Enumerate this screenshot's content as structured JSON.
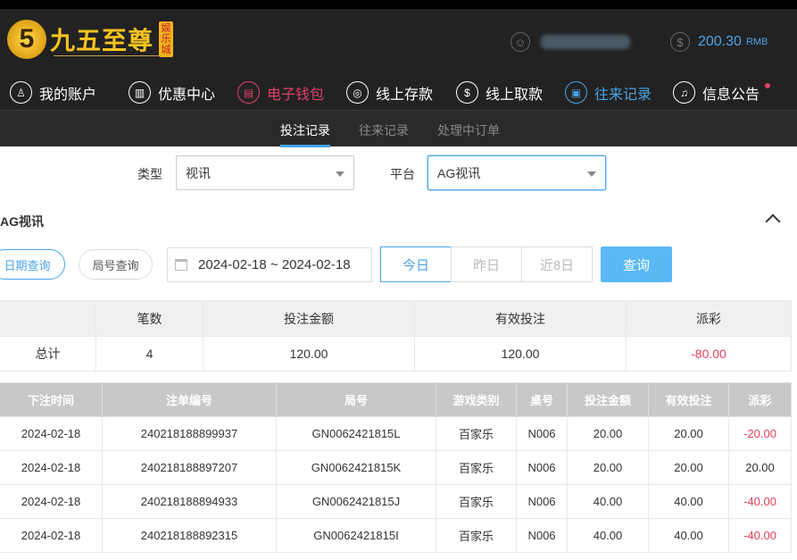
{
  "header": {
    "logo_mark": "5",
    "logo_text": "九五至尊",
    "logo_badge": "娱乐城",
    "balance": "200.30",
    "currency": "RMB"
  },
  "nav": [
    {
      "label": "我的账户",
      "icon": "user-icon"
    },
    {
      "label": "优惠中心",
      "icon": "gift-icon"
    },
    {
      "label": "电子钱包",
      "icon": "wallet-icon"
    },
    {
      "label": "线上存款",
      "icon": "deposit-icon"
    },
    {
      "label": "线上取款",
      "icon": "withdraw-icon"
    },
    {
      "label": "往来记录",
      "icon": "records-icon"
    },
    {
      "label": "信息公告",
      "icon": "bell-icon"
    }
  ],
  "subtabs": [
    "投注记录",
    "往来记录",
    "处理中订单"
  ],
  "filters": {
    "type_label": "类型",
    "type_value": "视讯",
    "platform_label": "平台",
    "platform_value": "AG视讯"
  },
  "section_title": "AG视讯",
  "query": {
    "date_query": "日期查询",
    "round_query": "局号查询",
    "date_range": "2024-02-18 ~ 2024-02-18",
    "today": "今日",
    "yesterday": "昨日",
    "last8": "近8日",
    "submit": "查询"
  },
  "summary": {
    "headers": [
      "",
      "笔数",
      "投注金额",
      "有效投注",
      "派彩"
    ],
    "row": [
      "总计",
      "4",
      "120.00",
      "120.00",
      "-80.00"
    ]
  },
  "details": {
    "headers": [
      "下注时间",
      "注单编号",
      "局号",
      "游戏类别",
      "桌号",
      "投注金额",
      "有效投注",
      "派彩"
    ],
    "rows": [
      [
        "2024-02-18",
        "240218188899937",
        "GN0062421815L",
        "百家乐",
        "N006",
        "20.00",
        "20.00",
        "-20.00"
      ],
      [
        "2024-02-18",
        "240218188897207",
        "GN0062421815K",
        "百家乐",
        "N006",
        "20.00",
        "20.00",
        "20.00"
      ],
      [
        "2024-02-18",
        "240218188894933",
        "GN0062421815J",
        "百家乐",
        "N006",
        "40.00",
        "40.00",
        "-40.00"
      ],
      [
        "2024-02-18",
        "240218188892315",
        "GN0062421815I",
        "百家乐",
        "N006",
        "40.00",
        "40.00",
        "-40.00"
      ]
    ]
  }
}
